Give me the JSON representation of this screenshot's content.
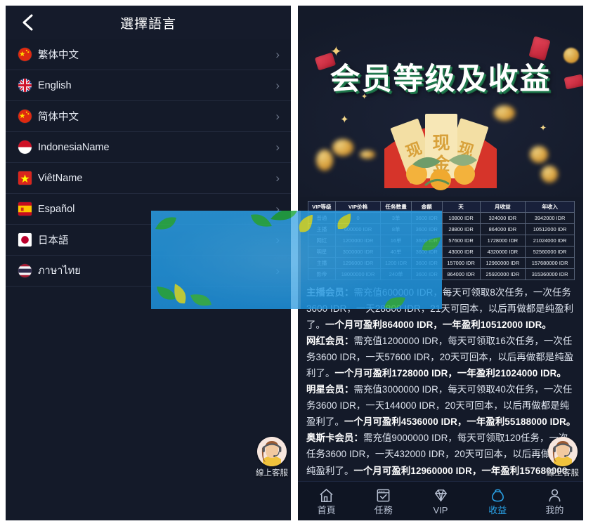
{
  "language_panel": {
    "title": "選擇語言",
    "back_icon": "chevron-left-icon",
    "items": [
      {
        "label": "繁体中文",
        "flag": "flag-cn",
        "chevron": "›"
      },
      {
        "label": "English",
        "flag": "flag-gb",
        "chevron": "›"
      },
      {
        "label": "简体中文",
        "flag": "flag-cn",
        "chevron": "›"
      },
      {
        "label": "IndonesiaName",
        "flag": "flag-id",
        "chevron": "›"
      },
      {
        "label": "ViêtName",
        "flag": "flag-vn",
        "chevron": "›"
      },
      {
        "label": "Español",
        "flag": "flag-es",
        "chevron": "›"
      },
      {
        "label": "日本語",
        "flag": "flag-jp",
        "chevron": "›"
      },
      {
        "label": "ภาษาไทย",
        "flag": "flag-th",
        "chevron": "›"
      }
    ]
  },
  "customer_service": {
    "label": "線上客服",
    "icon": "headset-operator-icon"
  },
  "vip_panel": {
    "banner_title": "会员等级及收益",
    "table": {
      "headers": [
        "VIP等级",
        "VIP价格",
        "任务数量",
        "金额",
        "天",
        "月收益",
        "年收入"
      ],
      "rows": [
        [
          "普通",
          "0",
          "3单",
          "3600 IDR",
          "10800 IDR",
          "324000 IDR",
          "3942000 IDR"
        ],
        [
          "主播",
          "600000 IDR",
          "8单",
          "3600 IDR",
          "28800 IDR",
          "864000 IDR",
          "10512000 IDR"
        ],
        [
          "网红",
          "1200000 IDR",
          "16单",
          "3600 IDR",
          "57600 IDR",
          "1728000 IDR",
          "21024000 IDR"
        ],
        [
          "明星",
          "3000000 IDR",
          "40单",
          "3600 IDR",
          "43000 IDR",
          "4320000 IDR",
          "52560000 IDR"
        ],
        [
          "主播",
          "1296000 IDR",
          "1200 IDR",
          "3600 IDR",
          "157000 IDR",
          "12960000 IDR",
          "157680000 IDR"
        ],
        [
          "影帝",
          "18000000 IDR",
          "240单",
          "3600 IDR",
          "864000 IDR",
          "25920000 IDR",
          "315360000 IDR"
        ]
      ]
    },
    "description": [
      {
        "lead": "主播会员：",
        "body": "需充值600000 IDR，每天可领取8次任务，一次任务3600 IDR，一天28800 IDR，21天可回本，以后再做都是纯盈利了。",
        "tail": "一个月可盈利864000 IDR，一年盈利10512000 IDR。"
      },
      {
        "lead": "网红会员：",
        "body": "需充值1200000 IDR，每天可领取16次任务，一次任务3600 IDR，一天57600   IDR，20天可回本，以后再做都是纯盈利了。",
        "tail": "一个月可盈利1728000 IDR，一年盈利21024000 IDR。"
      },
      {
        "lead": "明星会员：",
        "body": "需充值3000000 IDR，每天可领取40次任务，一次任务3600 IDR，一天144000 IDR，20天可回本，以后再做都是纯盈利了。",
        "tail": "一个月可盈利4536000 IDR，一年盈利55188000 IDR。"
      },
      {
        "lead": "奥斯卡会员：",
        "body": "需充值9000000 IDR，每天可领取120任务，一次任务3600 IDR，一天432000 IDR，20天可回本，以后再做都是纯盈利了。",
        "tail": "一个月可盈利12960000 IDR，一年盈利157680000 IDR。"
      }
    ],
    "tabs": [
      {
        "label": "首頁",
        "icon": "home-icon",
        "active": false
      },
      {
        "label": "任務",
        "icon": "task-icon",
        "active": false
      },
      {
        "label": "VIP",
        "icon": "diamond-icon",
        "active": false
      },
      {
        "label": "收益",
        "icon": "purse-icon",
        "active": true
      },
      {
        "label": "我的",
        "icon": "person-icon",
        "active": false
      }
    ]
  },
  "colors": {
    "panel_bg": "#141a29",
    "accent": "#2aa3e8",
    "overlay_blue": "#2196e0",
    "text": "#dfe5f0"
  }
}
